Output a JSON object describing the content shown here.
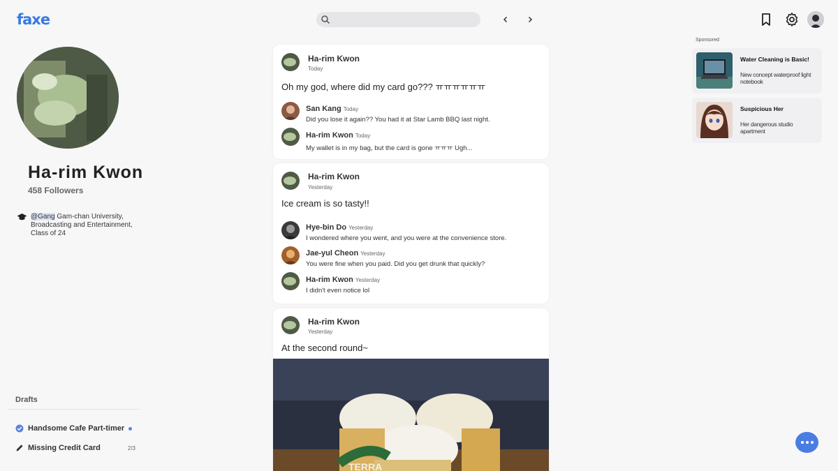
{
  "app": {
    "logo": "faxe"
  },
  "profile": {
    "name": "Ha-rim Kwon",
    "followers": "458 Followers",
    "education_handle": "@Gang",
    "education_text": " Gam-chan University, Broadcasting and Entertainment, Class of 24"
  },
  "drafts": {
    "title": "Drafts",
    "items": [
      {
        "label": "Handsome Cafe Part-timer",
        "icon": "check-circle-icon"
      },
      {
        "label": "Missing Credit Card",
        "icon": "pencil-icon",
        "count": "2/3"
      }
    ]
  },
  "posts": [
    {
      "author": "Ha-rim Kwon",
      "time": "Today",
      "text": "Oh my god, where did my card go??? ㅠㅠㅠㅠㅠㅠ",
      "comments": [
        {
          "author": "San Kang",
          "time": "Today",
          "text": "Did you lose it again?? You had it at Star Lamb BBQ last night."
        },
        {
          "author": "Ha-rim Kwon",
          "time": "Today",
          "text": "My wallet is in my bag, but the card is gone ㅠㅠㅠ Ugh..."
        }
      ]
    },
    {
      "author": "Ha-rim Kwon",
      "time": "Yesterday",
      "text": "Ice cream is so tasty!!",
      "comments": [
        {
          "author": "Hye-bin Do",
          "time": "Yesterday",
          "text": "I wondered where you went, and you were at the convenience store."
        },
        {
          "author": "Jae-yul Cheon",
          "time": "Yesterday",
          "text": "You were fine when you paid. Did you get drunk that quickly?"
        },
        {
          "author": "Ha-rim Kwon",
          "time": "Yesterday",
          "text": "I didn't even notice lol"
        }
      ]
    },
    {
      "author": "Ha-rim Kwon",
      "time": "Yesterday",
      "text": "At the second round~",
      "photo_label": "TERRA"
    }
  ],
  "ads": {
    "label": "Sponsored",
    "items": [
      {
        "title": "Water Cleaning is Basic!",
        "desc": "New concept waterproof light notebook"
      },
      {
        "title": "Suspicious Her",
        "desc": "Her dangerous studio apartment"
      }
    ]
  },
  "colors": {
    "accent": "#3a79e0",
    "chat_button": "#4a7de2"
  }
}
